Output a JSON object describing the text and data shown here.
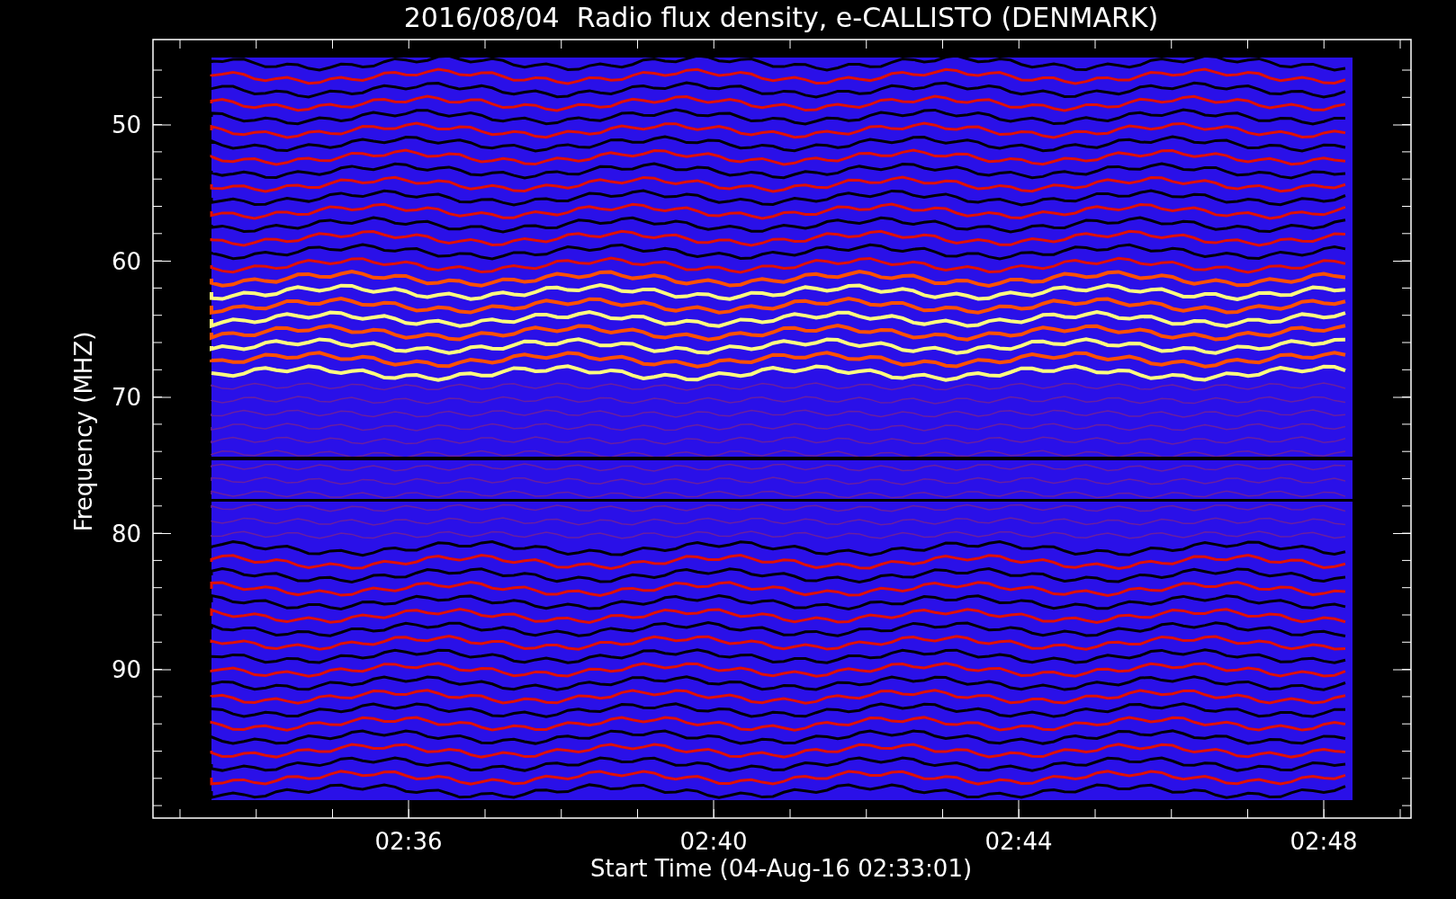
{
  "title": "2016/08/04  Radio flux density, e-CALLISTO (DENMARK)",
  "y_axis": {
    "label": "Frequency (MHZ)",
    "ticks": [
      "50",
      "60",
      "70",
      "80",
      "90"
    ]
  },
  "x_axis": {
    "label": "Start Time (04-Aug-16 02:33:01)",
    "ticks": [
      "02:36",
      "02:40",
      "02:44",
      "02:48"
    ]
  }
}
